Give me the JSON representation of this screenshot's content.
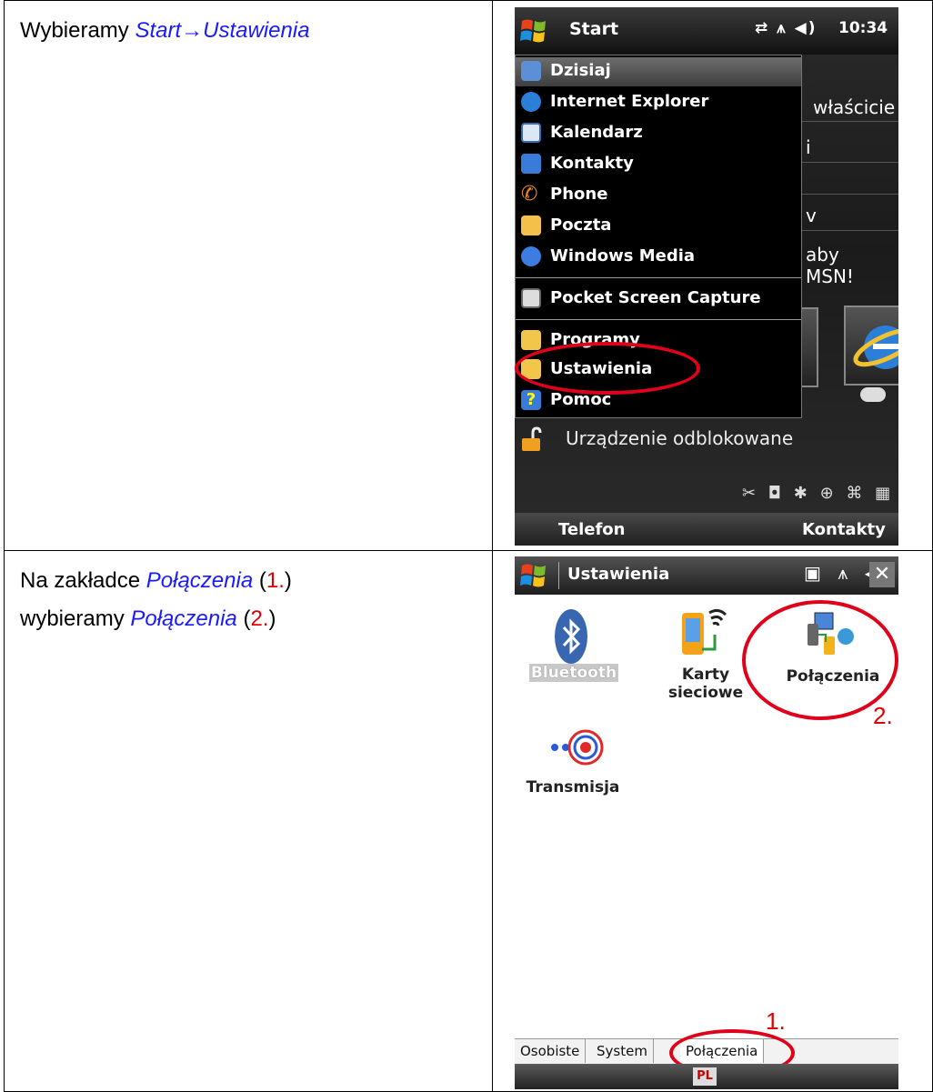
{
  "row1": {
    "instruction_prefix": "Wybieramy ",
    "instruction_link": "Start→Ustawienia"
  },
  "row2": {
    "line1_prefix": "Na zakładce ",
    "line1_link": "Połączenia",
    "line1_open": " (",
    "line1_num": "1.",
    "line1_close": ")",
    "line2_prefix": "wybieramy ",
    "line2_link": "Połączenia",
    "line2_open": " (",
    "line2_num": "2.",
    "line2_close": ")"
  },
  "screen1": {
    "title": "Start",
    "time": "10:34",
    "menu_items": [
      "Dzisiaj",
      "Internet Explorer",
      "Kalendarz",
      "Kontakty",
      "Phone",
      "Poczta",
      "Windows Media",
      "Pocket Screen Capture",
      "Programy",
      "Ustawienia",
      "Pomoc"
    ],
    "background_fragments": [
      "właścicie",
      "i",
      "v",
      "aby",
      "MSN!"
    ],
    "lock_status": "Urządzenie odblokowane",
    "softkey_left": "Telefon",
    "softkey_right": "Kontakty"
  },
  "screen2": {
    "title": "Ustawienia",
    "close": "✕",
    "icons": [
      {
        "label": "Bluetooth"
      },
      {
        "label": "Karty sieciowe"
      },
      {
        "label": "Połączenia"
      },
      {
        "label": "Transmisja"
      }
    ],
    "tabs": [
      "Osobiste",
      "System",
      "Połączenia"
    ],
    "input_indicator": "PL",
    "annotation_1": "1.",
    "annotation_2": "2."
  },
  "colors": {
    "link": "#1a1aff",
    "annotation": "#e00000",
    "highlight_ellipse": "#e0001a"
  }
}
